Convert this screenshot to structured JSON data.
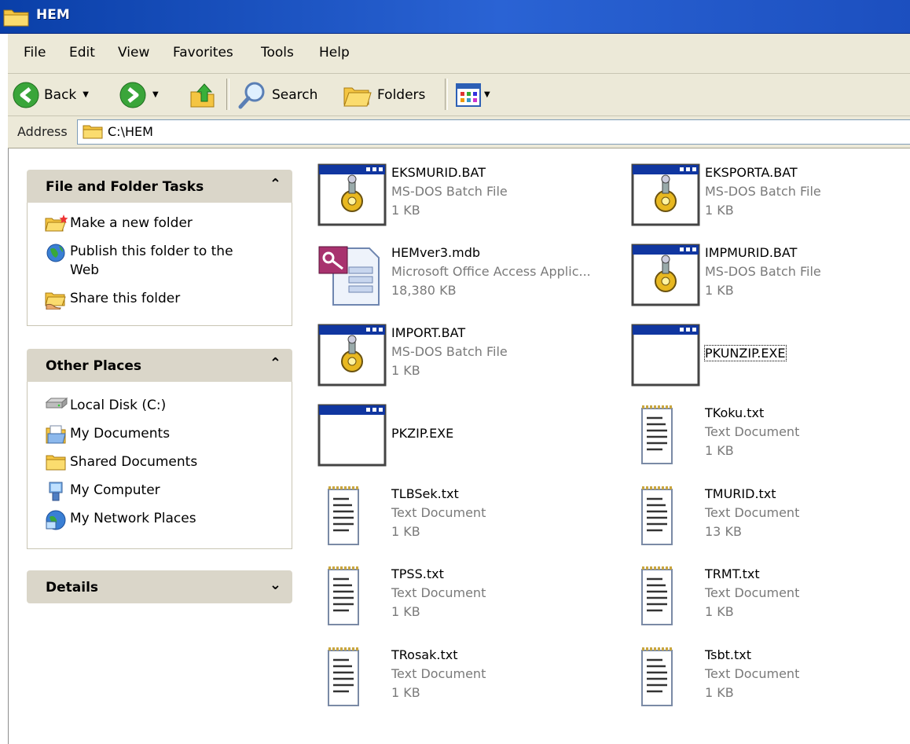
{
  "window": {
    "title": "HEM"
  },
  "menu": [
    "File",
    "Edit",
    "View",
    "Favorites",
    "Tools",
    "Help"
  ],
  "toolbar": {
    "back": "Back",
    "search": "Search",
    "folders": "Folders"
  },
  "address": {
    "label": "Address",
    "path": "C:\\HEM"
  },
  "panels": {
    "file_tasks": {
      "title": "File and Folder Tasks",
      "items": [
        "Make a new folder",
        "Publish this folder to the Web",
        "Share this folder"
      ]
    },
    "other_places": {
      "title": "Other Places",
      "items": [
        "Local Disk (C:)",
        "My Documents",
        "Shared Documents",
        "My Computer",
        "My Network Places"
      ]
    },
    "details": {
      "title": "Details"
    }
  },
  "files": [
    {
      "name": "EKSMURID.BAT",
      "type": "MS-DOS Batch File",
      "size": "1 KB",
      "icon": "batch-icon"
    },
    {
      "name": "EKSPORTA.BAT",
      "type": "MS-DOS Batch File",
      "size": "1 KB",
      "icon": "batch-icon"
    },
    {
      "name": "HEMver3.mdb",
      "type": "Microsoft Office Access Applic...",
      "size": "18,380 KB",
      "icon": "access-icon"
    },
    {
      "name": "IMPMURID.BAT",
      "type": "MS-DOS Batch File",
      "size": "1 KB",
      "icon": "batch-icon"
    },
    {
      "name": "IMPORT.BAT",
      "type": "MS-DOS Batch File",
      "size": "1 KB",
      "icon": "batch-icon"
    },
    {
      "name": "PKUNZIP.EXE",
      "type": "",
      "size": "",
      "icon": "exe-icon"
    },
    {
      "name": "PKZIP.EXE",
      "type": "",
      "size": "",
      "icon": "exe-icon"
    },
    {
      "name": "TKoku.txt",
      "type": "Text Document",
      "size": "1 KB",
      "icon": "text-document-icon"
    },
    {
      "name": "TLBSek.txt",
      "type": "Text Document",
      "size": "1 KB",
      "icon": "text-document-icon"
    },
    {
      "name": "TMURID.txt",
      "type": "Text Document",
      "size": "13 KB",
      "icon": "text-document-icon"
    },
    {
      "name": "TPSS.txt",
      "type": "Text Document",
      "size": "1 KB",
      "icon": "text-document-icon"
    },
    {
      "name": "TRMT.txt",
      "type": "Text Document",
      "size": "1 KB",
      "icon": "text-document-icon"
    },
    {
      "name": "TRosak.txt",
      "type": "Text Document",
      "size": "1 KB",
      "icon": "text-document-icon"
    },
    {
      "name": "Tsbt.txt",
      "type": "Text Document",
      "size": "1 KB",
      "icon": "text-document-icon"
    }
  ]
}
